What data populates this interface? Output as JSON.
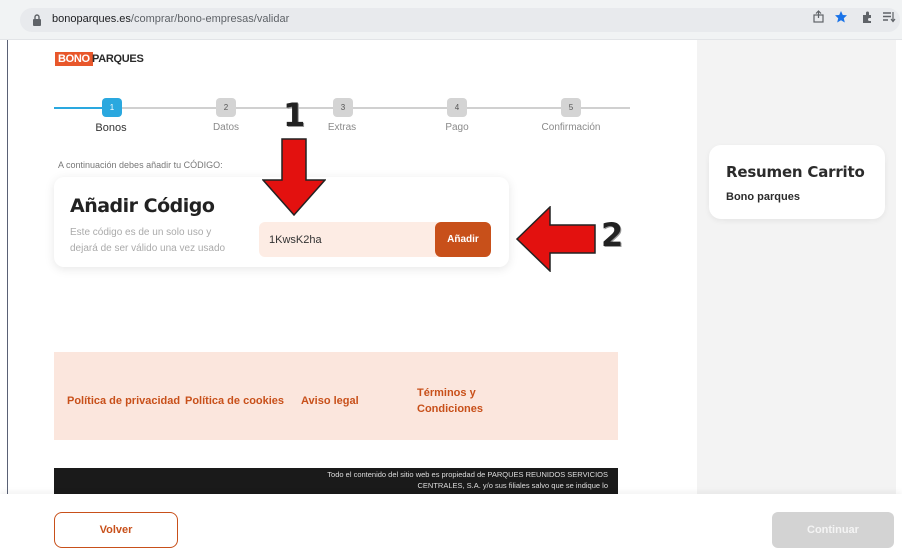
{
  "browser": {
    "url_host": "bonoparques.es",
    "url_path": "/comprar/bono-empresas/validar",
    "icons": [
      "lock-icon",
      "share-icon",
      "star-icon",
      "extensions-icon",
      "reading-list-icon"
    ]
  },
  "logo": {
    "part1": "BONO",
    "part2": "PARQUES"
  },
  "stepper": {
    "steps": [
      {
        "number": "1",
        "label": "Bonos",
        "active": true
      },
      {
        "number": "2",
        "label": "Datos",
        "active": false
      },
      {
        "number": "3",
        "label": "Extras",
        "active": false
      },
      {
        "number": "4",
        "label": "Pago",
        "active": false
      },
      {
        "number": "5",
        "label": "Confirmación",
        "active": false
      }
    ]
  },
  "intro": "A continuación debes añadir tu CÓDIGO:",
  "code_card": {
    "title": "Añadir Código",
    "description": "Este código es de un solo uso y dejará de ser válido una vez usado",
    "input_value": "1KwsK2ha",
    "add_button": "Añadir"
  },
  "annotations": {
    "one": "1",
    "two": "2"
  },
  "summary": {
    "title": "Resumen Carrito",
    "subtitle": "Bono parques"
  },
  "footer_links": [
    "Política de privacidad",
    "Política de cookies",
    "Aviso legal",
    "Términos y Condiciones"
  ],
  "legal_text": "Todo el contenido del sitio web es propiedad de PARQUES REUNIDOS SERVICIOS CENTRALES, S.A. y/o sus filiales salvo que se indique lo",
  "bottom": {
    "back_button": "Volver",
    "continue_button": "Continuar"
  },
  "colors": {
    "accent": "#c8501a",
    "logo_orange": "#e8572b",
    "step_active": "#2aa8df",
    "arrow_red": "#e3110f",
    "input_bg": "#fdece4"
  }
}
